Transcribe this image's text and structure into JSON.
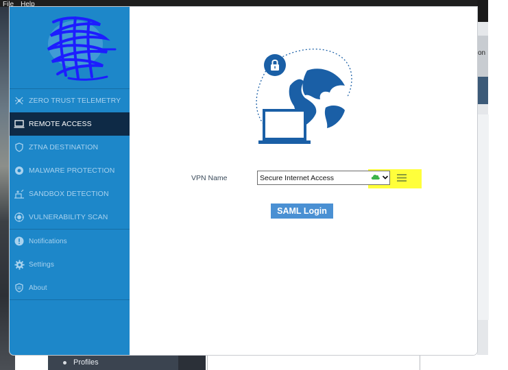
{
  "menubar": {
    "file": "File",
    "help": "Help"
  },
  "sidebar": {
    "items": [
      {
        "label": "ZERO TRUST TELEMETRY",
        "icon": "telemetry-icon",
        "active": false
      },
      {
        "label": "REMOTE ACCESS",
        "icon": "laptop-icon",
        "active": true
      },
      {
        "label": "ZTNA DESTINATION",
        "icon": "shield-icon",
        "active": false
      },
      {
        "label": "MALWARE PROTECTION",
        "icon": "malware-icon",
        "active": false
      },
      {
        "label": "SANDBOX DETECTION",
        "icon": "sandbox-icon",
        "active": false
      },
      {
        "label": "VULNERABILITY SCAN",
        "icon": "vulnerability-icon",
        "active": false
      }
    ],
    "secondary": [
      {
        "label": "Notifications",
        "icon": "notification-icon"
      },
      {
        "label": "Settings",
        "icon": "gear-icon"
      },
      {
        "label": "About",
        "icon": "about-shield-icon"
      }
    ]
  },
  "main": {
    "vpn_label": "VPN Name",
    "vpn_selected": "Secure Internet Access",
    "saml_button": "SAML Login"
  },
  "background": {
    "profiles_label": "Profiles",
    "peek_text": "on"
  },
  "colors": {
    "sidebar": "#1d87c9",
    "active_item": "#0e2a46",
    "accent": "#4a90d3",
    "highlight": "#ffff3b",
    "cloud": "#3db54a",
    "icon_dark": "#1a5fa6"
  }
}
